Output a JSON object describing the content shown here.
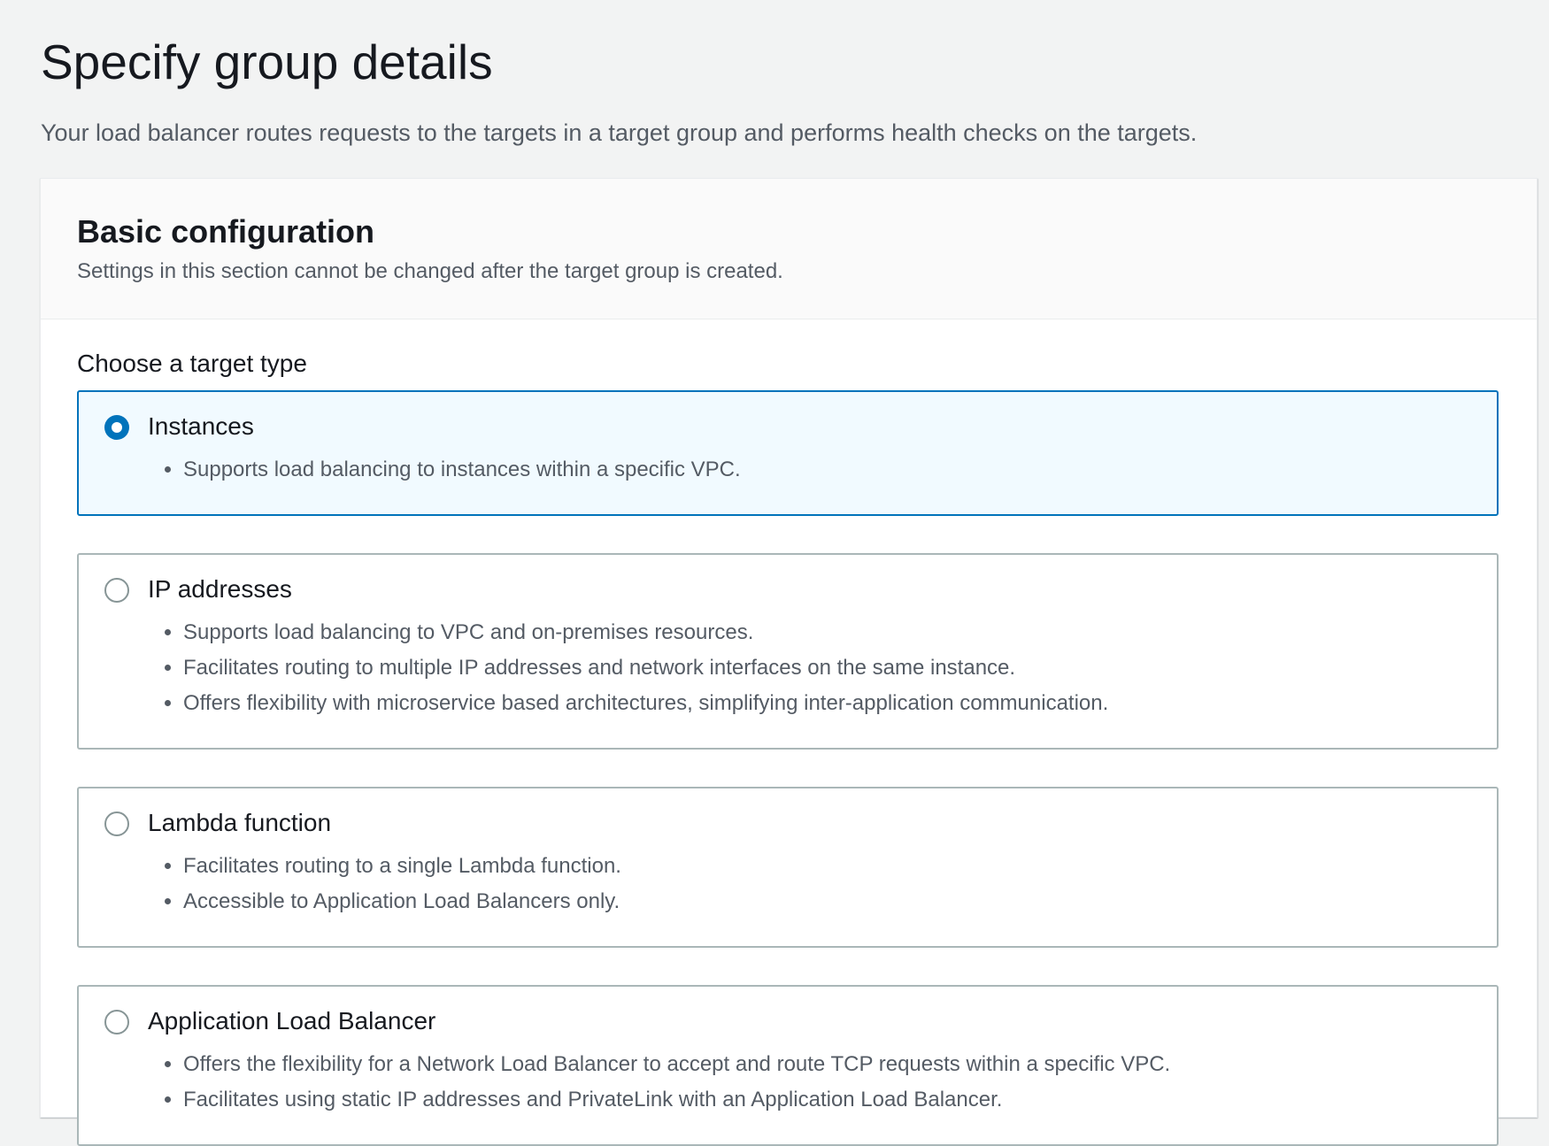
{
  "page": {
    "title": "Specify group details",
    "description": "Your load balancer routes requests to the targets in a target group and performs health checks on the targets."
  },
  "panel": {
    "title": "Basic configuration",
    "description": "Settings in this section cannot be changed after the target group is created.",
    "field_label": "Choose a target type",
    "selected_option": "Instances",
    "options": [
      {
        "label": "Instances",
        "bullets": [
          "Supports load balancing to instances within a specific VPC."
        ]
      },
      {
        "label": "IP addresses",
        "bullets": [
          "Supports load balancing to VPC and on-premises resources.",
          "Facilitates routing to multiple IP addresses and network interfaces on the same instance.",
          "Offers flexibility with microservice based architectures, simplifying inter-application communication."
        ]
      },
      {
        "label": "Lambda function",
        "bullets": [
          "Facilitates routing to a single Lambda function.",
          "Accessible to Application Load Balancers only."
        ]
      },
      {
        "label": "Application Load Balancer",
        "bullets": [
          "Offers the flexibility for a Network Load Balancer to accept and route TCP requests within a specific VPC.",
          "Facilitates using static IP addresses and PrivateLink with an Application Load Balancer."
        ]
      }
    ]
  },
  "colors": {
    "accent": "#0073bb",
    "selected_background": "#f1faff",
    "page_background": "#f2f3f3",
    "text_primary": "#16191f",
    "text_secondary": "#545b64"
  }
}
